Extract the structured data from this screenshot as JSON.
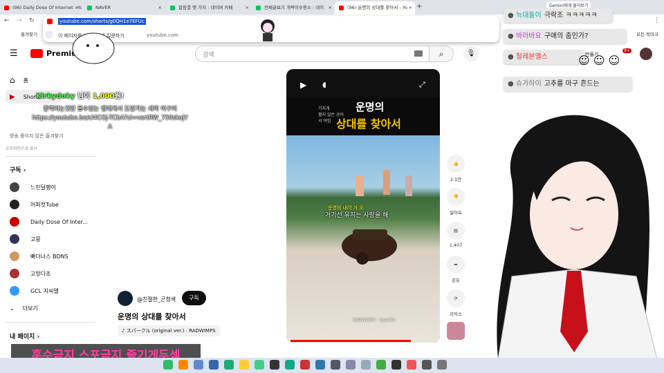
{
  "tabs": [
    {
      "label": "(96) Daily Dose Of Internet - Yo",
      "color": "#ff0000",
      "active": false
    },
    {
      "label": "NAVER",
      "color": "#03c75a",
      "active": false
    },
    {
      "label": "합잠결 옛 가지 : 네이버 카페",
      "color": "#03c75a",
      "active": false
    },
    {
      "label": "전체글보기 개짝이수용소 : 네이",
      "color": "#03c75a",
      "active": false
    },
    {
      "label": "(96) 운명의 상대를 찾아서 - Yo",
      "color": "#ff0000",
      "active": true
    }
  ],
  "address": {
    "url": "youtube.com/shorts/g0QH1e7EFUc",
    "suggest_text": "이 페이지를 Google에 질문하기",
    "suggest_site": "youtube.com",
    "bookmark": "즐겨찾기",
    "bookmark_right": "모든 북마크"
  },
  "header": {
    "logo": "Premium",
    "search_placeholder": "검색",
    "create": "만들기",
    "badge": "9+",
    "gemini": "Gemini에게 물어보기"
  },
  "sidebar": {
    "home": "홈",
    "shorts": "Shorts",
    "history_note": "방송 중이지 않은 즐겨찾기",
    "offline_note": "오프라인으로 표시",
    "subs_title": "구독",
    "subs": [
      {
        "name": "느린달팽이",
        "color": "#444"
      },
      {
        "name": "어퍼컷Tube",
        "color": "#222"
      },
      {
        "name": "Daily Dose Of Inter...",
        "color": "#c00"
      },
      {
        "name": "고몽",
        "color": "#335"
      },
      {
        "name": "빠더너스 BDNS",
        "color": "#c96"
      },
      {
        "name": "고망다조",
        "color": "#a33"
      },
      {
        "name": "GCL 지씨엘",
        "color": "#39f"
      }
    ],
    "more": "더보기",
    "mypage": "내 페이지"
  },
  "overlay": {
    "donation_user": "Kirkydoky",
    "donation_suffix": " 님이 ",
    "donation_amount": "1,000",
    "donation_unit": "원!",
    "donation_msg1": "좋역미는것만 볼수있는 펭에게서 도망가는 새끼 이구여",
    "donation_msg2": "https://youtube.be/cl4COj-TCbA?si=vartRW_750skajY",
    "donation_msg3": "A",
    "banner": "훈수금지 스포금지 즐기게두셈"
  },
  "video": {
    "text_small1": "기지개",
    "text_small2": "펼지 않은 공어서 여밈",
    "title_line1": "운명의",
    "title_line2": "상대를 찾아서",
    "caption": "거기선 유지는 사랑을 해",
    "caption_top": "운명의 내려 가 오",
    "bottom_tag": "RADWIMPS - Sparkle",
    "channel": "@친절한_군청색",
    "subscribe": "구독",
    "name": "운명의 상대를 찾아서",
    "music": "スパークル (original ver.) · RADWIMPS"
  },
  "actions": {
    "like": "2.1만",
    "dislike": "싫어요",
    "comment": "1,407",
    "share": "공유",
    "remix": "리믹스"
  },
  "chat": [
    {
      "name": "늑대돌이",
      "msg": "극락조 ㅋㅋㅋㅋㅋ",
      "name_color": "#0aa"
    },
    {
      "name": "바라바요",
      "msg": "구애의 춤인가?",
      "name_color": "#c3c"
    },
    {
      "name": "철레본옐스",
      "msg": "",
      "name_color": "#e33"
    },
    {
      "name": "슈가하이",
      "msg": "고추를 마구 흔드는",
      "name_color": "#777"
    }
  ]
}
